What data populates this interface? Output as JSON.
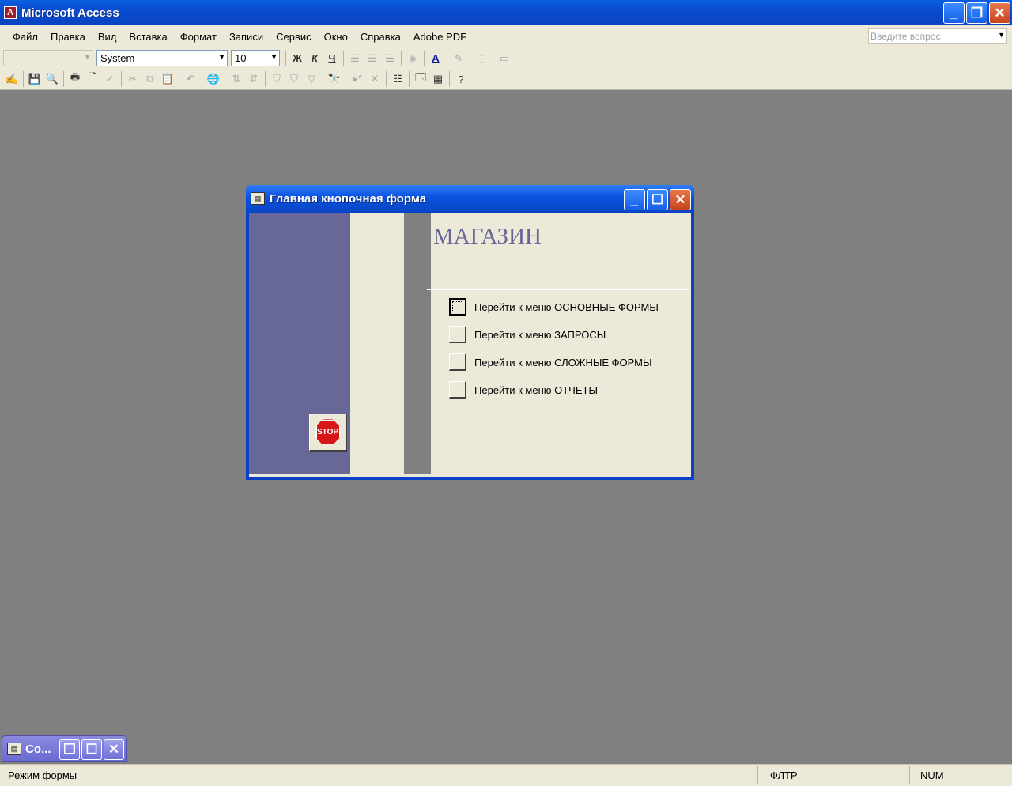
{
  "app": {
    "title": "Microsoft Access"
  },
  "menu": {
    "items": [
      "Файл",
      "Правка",
      "Вид",
      "Вставка",
      "Формат",
      "Записи",
      "Сервис",
      "Окно",
      "Справка",
      "Adobe PDF"
    ],
    "help_placeholder": "Введите вопрос"
  },
  "formatting": {
    "object_combo": "",
    "font": "System",
    "size": "10"
  },
  "form_window": {
    "title": "Главная кнопочная форма",
    "heading": "МАГАЗИН",
    "items": [
      "Перейти к меню ОСНОВНЫЕ ФОРМЫ",
      "Перейти к меню ЗАПРОСЫ",
      "Перейти к меню СЛОЖНЫЕ ФОРМЫ",
      "Перейти к меню ОТЧЕТЫ"
    ],
    "stop_label": "STOP"
  },
  "minimized_window": {
    "title": "Co..."
  },
  "status": {
    "mode": "Режим формы",
    "filter": "ФЛТР",
    "num": "NUM"
  },
  "colors": {
    "titlebar": "#0a4bd0",
    "band": "#686898",
    "heading": "#686898",
    "chrome": "#ece9d8"
  }
}
